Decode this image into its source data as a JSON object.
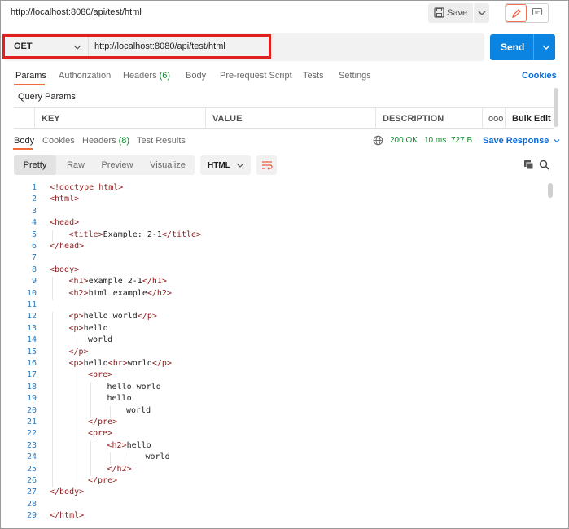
{
  "header": {
    "title": "http://localhost:8080/api/test/html",
    "save_label": "Save"
  },
  "request": {
    "method": "GET",
    "url": "http://localhost:8080/api/test/html",
    "send_label": "Send",
    "highlight_color": "#e0201e"
  },
  "request_tabs": [
    {
      "label": "Params",
      "count": ""
    },
    {
      "label": "Authorization",
      "count": ""
    },
    {
      "label": "Headers",
      "count": "(6)"
    },
    {
      "label": "Body",
      "count": ""
    },
    {
      "label": "Pre-request Script",
      "count": ""
    },
    {
      "label": "Tests",
      "count": ""
    },
    {
      "label": "Settings",
      "count": ""
    }
  ],
  "cookies_label": "Cookies",
  "query_params": {
    "title": "Query Params",
    "columns": [
      "KEY",
      "VALUE",
      "DESCRIPTION"
    ],
    "more_icon": "ooo",
    "bulk_edit": "Bulk Edit"
  },
  "response_tabs": [
    {
      "label": "Body",
      "count": ""
    },
    {
      "label": "Cookies",
      "count": ""
    },
    {
      "label": "Headers",
      "count": "(8)"
    },
    {
      "label": "Test Results",
      "count": ""
    }
  ],
  "response_meta": {
    "status": "200 OK",
    "time": "10 ms",
    "size": "727 B",
    "save_response": "Save Response"
  },
  "view_modes": [
    "Pretty",
    "Raw",
    "Preview",
    "Visualize"
  ],
  "format": "HTML",
  "code_lines": [
    {
      "n": "1",
      "indent": 0,
      "html": "<span class='tag'>&lt;!doctype html&gt;</span>"
    },
    {
      "n": "2",
      "indent": 0,
      "html": "<span class='tag'>&lt;html&gt;</span>"
    },
    {
      "n": "3",
      "indent": 0,
      "html": ""
    },
    {
      "n": "4",
      "indent": 0,
      "html": "<span class='tag'>&lt;head&gt;</span>"
    },
    {
      "n": "5",
      "indent": 1,
      "html": "<span class='tag'>&lt;title&gt;</span>Example: 2-1<span class='tag'>&lt;/title&gt;</span>"
    },
    {
      "n": "6",
      "indent": 0,
      "html": "<span class='tag'>&lt;/head&gt;</span>"
    },
    {
      "n": "7",
      "indent": 0,
      "html": ""
    },
    {
      "n": "8",
      "indent": 0,
      "html": "<span class='tag'>&lt;body&gt;</span>"
    },
    {
      "n": "9",
      "indent": 1,
      "html": "<span class='tag'>&lt;h1&gt;</span>example 2-1<span class='tag'>&lt;/h1&gt;</span>"
    },
    {
      "n": "10",
      "indent": 1,
      "html": "<span class='tag'>&lt;h2&gt;</span>html example<span class='tag'>&lt;/h2&gt;</span>"
    },
    {
      "n": "11",
      "indent": 0,
      "html": ""
    },
    {
      "n": "12",
      "indent": 1,
      "html": "<span class='tag'>&lt;p&gt;</span>hello world<span class='tag'>&lt;/p&gt;</span>"
    },
    {
      "n": "13",
      "indent": 1,
      "html": "<span class='tag'>&lt;p&gt;</span>hello"
    },
    {
      "n": "14",
      "indent": 2,
      "html": "world"
    },
    {
      "n": "15",
      "indent": 1,
      "html": "<span class='tag'>&lt;/p&gt;</span>"
    },
    {
      "n": "16",
      "indent": 1,
      "html": "<span class='tag'>&lt;p&gt;</span>hello<span class='tag'>&lt;br&gt;</span>world<span class='tag'>&lt;/p&gt;</span>"
    },
    {
      "n": "17",
      "indent": 2,
      "html": "<span class='tag'>&lt;pre&gt;</span>"
    },
    {
      "n": "18",
      "indent": 3,
      "html": "hello world"
    },
    {
      "n": "19",
      "indent": 3,
      "html": "hello"
    },
    {
      "n": "20",
      "indent": 4,
      "html": "world"
    },
    {
      "n": "21",
      "indent": 2,
      "html": "<span class='tag'>&lt;/pre&gt;</span>"
    },
    {
      "n": "22",
      "indent": 2,
      "html": "<span class='tag'>&lt;pre&gt;</span>"
    },
    {
      "n": "23",
      "indent": 3,
      "html": "<span class='tag'>&lt;h2&gt;</span>hello"
    },
    {
      "n": "24",
      "indent": 5,
      "html": "world"
    },
    {
      "n": "25",
      "indent": 3,
      "html": "<span class='tag'>&lt;/h2&gt;</span>"
    },
    {
      "n": "26",
      "indent": 2,
      "html": "<span class='tag'>&lt;/pre&gt;</span>"
    },
    {
      "n": "27",
      "indent": 0,
      "html": "<span class='tag'>&lt;/body&gt;</span>"
    },
    {
      "n": "28",
      "indent": 0,
      "html": ""
    },
    {
      "n": "29",
      "indent": 0,
      "html": "<span class='tag'>&lt;/html&gt;</span>"
    }
  ]
}
